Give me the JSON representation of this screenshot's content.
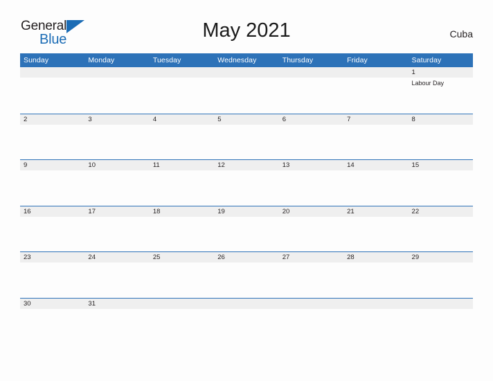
{
  "brand": {
    "name_part1": "General",
    "name_part2": "Blue",
    "colors": {
      "dark": "#231f20",
      "blue": "#1b6cb5"
    }
  },
  "header": {
    "title": "May 2021",
    "country": "Cuba"
  },
  "theme": {
    "header_blue": "#2d72b8",
    "row_divider_blue": "#2d72b8",
    "day_band_gray": "#efefef",
    "page_background": "#fdfdfd",
    "text_dark": "#231f20",
    "weekday_text": "#ffffff"
  },
  "calendar": {
    "month": "May",
    "year": "2021",
    "weekday_headers": [
      "Sunday",
      "Monday",
      "Tuesday",
      "Wednesday",
      "Thursday",
      "Friday",
      "Saturday"
    ],
    "weeks": [
      [
        {
          "day": "",
          "events": []
        },
        {
          "day": "",
          "events": []
        },
        {
          "day": "",
          "events": []
        },
        {
          "day": "",
          "events": []
        },
        {
          "day": "",
          "events": []
        },
        {
          "day": "",
          "events": []
        },
        {
          "day": "1",
          "events": [
            "Labour Day"
          ]
        }
      ],
      [
        {
          "day": "2",
          "events": []
        },
        {
          "day": "3",
          "events": []
        },
        {
          "day": "4",
          "events": []
        },
        {
          "day": "5",
          "events": []
        },
        {
          "day": "6",
          "events": []
        },
        {
          "day": "7",
          "events": []
        },
        {
          "day": "8",
          "events": []
        }
      ],
      [
        {
          "day": "9",
          "events": []
        },
        {
          "day": "10",
          "events": []
        },
        {
          "day": "11",
          "events": []
        },
        {
          "day": "12",
          "events": []
        },
        {
          "day": "13",
          "events": []
        },
        {
          "day": "14",
          "events": []
        },
        {
          "day": "15",
          "events": []
        }
      ],
      [
        {
          "day": "16",
          "events": []
        },
        {
          "day": "17",
          "events": []
        },
        {
          "day": "18",
          "events": []
        },
        {
          "day": "19",
          "events": []
        },
        {
          "day": "20",
          "events": []
        },
        {
          "day": "21",
          "events": []
        },
        {
          "day": "22",
          "events": []
        }
      ],
      [
        {
          "day": "23",
          "events": []
        },
        {
          "day": "24",
          "events": []
        },
        {
          "day": "25",
          "events": []
        },
        {
          "day": "26",
          "events": []
        },
        {
          "day": "27",
          "events": []
        },
        {
          "day": "28",
          "events": []
        },
        {
          "day": "29",
          "events": []
        }
      ],
      [
        {
          "day": "30",
          "events": []
        },
        {
          "day": "31",
          "events": []
        },
        {
          "day": "",
          "events": []
        },
        {
          "day": "",
          "events": []
        },
        {
          "day": "",
          "events": []
        },
        {
          "day": "",
          "events": []
        },
        {
          "day": "",
          "events": []
        }
      ]
    ]
  }
}
